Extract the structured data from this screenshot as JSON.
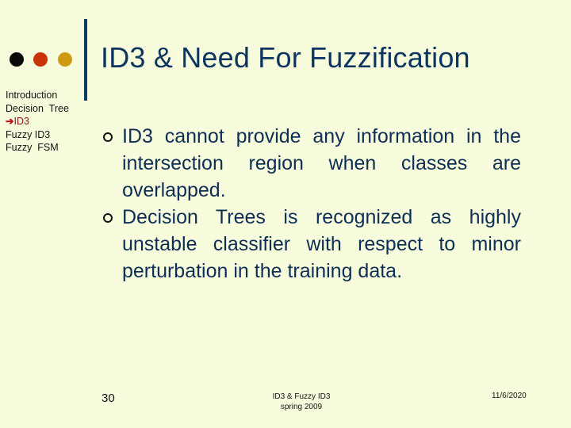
{
  "colors": {
    "background": "#f7fddc",
    "dot_1": "#0a0a0a",
    "dot_2": "#c83408",
    "dot_3": "#d09a10",
    "title": "#0e3560",
    "active_nav": "#8b1010"
  },
  "slide": {
    "title": "ID3 & Need For Fuzzification"
  },
  "nav": {
    "items": [
      {
        "label": "Introduction",
        "active": false
      },
      {
        "label": "Decision  Tree",
        "active": false
      },
      {
        "label": "ID3",
        "active": true,
        "icon": "arrow-right-icon",
        "icon_glyph": "➔"
      },
      {
        "label": "Fuzzy ID3",
        "active": false
      },
      {
        "label": "Fuzzy  FSM",
        "active": false
      }
    ]
  },
  "bullets": [
    {
      "icon": "hollow-circle-bullet-icon",
      "text": "ID3 cannot provide any information in the intersection region when classes are overlapped."
    },
    {
      "icon": "hollow-circle-bullet-icon",
      "text": "Decision Trees is recognized as highly unstable classifier with respect to minor perturbation in the training data."
    }
  ],
  "footer": {
    "page_number": "30",
    "center_line1": "ID3 & Fuzzy ID3",
    "center_line2": "spring 2009",
    "date": "11/6/2020"
  }
}
